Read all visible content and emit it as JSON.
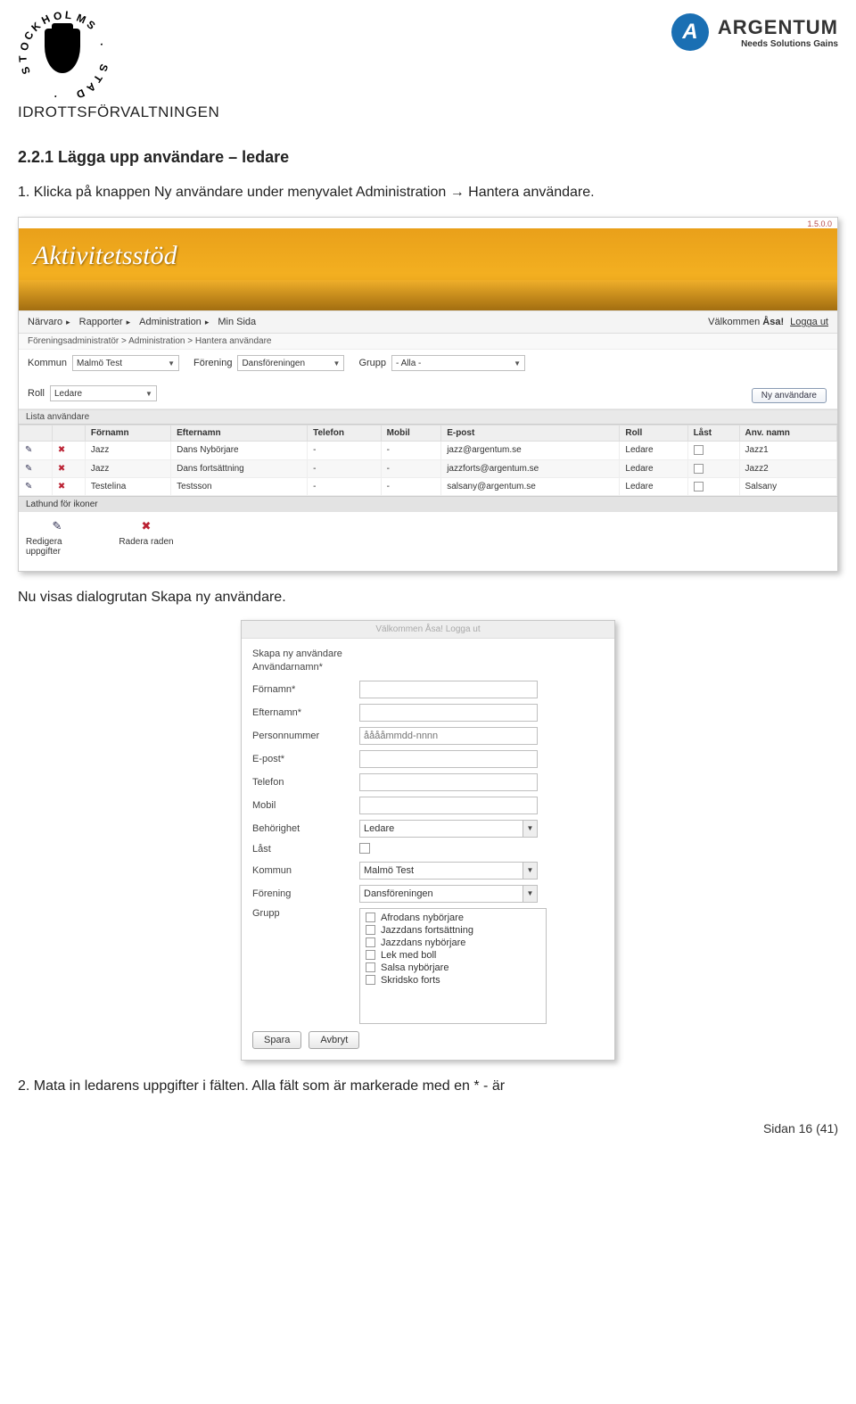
{
  "header": {
    "stockholm_ring_text": "STOCKHOLMS · STAD ·",
    "department": "IDROTTSFÖRVALTNINGEN",
    "argentum_letter": "A",
    "argentum_brand": "ARGENTUM",
    "argentum_tagline": "Needs  Solutions  Gains"
  },
  "section_title": "2.2.1 Lägga upp användare – ledare",
  "step1": "1. Klicka på knappen Ny användare under menyvalet Administration → Hantera användare.",
  "screenshot1": {
    "version": "1.5.0.0",
    "app_name": "Aktivitetsstöd",
    "tabs": [
      "Närvaro",
      "Rapporter",
      "Administration",
      "Min Sida"
    ],
    "welcome_pre": "Välkommen ",
    "welcome_name": "Åsa!",
    "logout": "Logga ut",
    "breadcrumb": "Föreningsadministratör > Administration > Hantera användare",
    "filters": {
      "kommun_label": "Kommun",
      "kommun_value": "Malmö Test",
      "forening_label": "Förening",
      "forening_value": "Dansföreningen",
      "grupp_label": "Grupp",
      "grupp_value": "- Alla -",
      "roll_label": "Roll",
      "roll_value": "Ledare"
    },
    "newuser_btn": "Ny användare",
    "list_label": "Lista användare",
    "columns": [
      "",
      "",
      "Förnamn",
      "Efternamn",
      "Telefon",
      "Mobil",
      "E-post",
      "Roll",
      "Låst",
      "Anv. namn"
    ],
    "rows": [
      {
        "fornamn": "Jazz",
        "efternamn": "Dans Nybörjare",
        "telefon": "-",
        "mobil": "-",
        "epost": "jazz@argentum.se",
        "roll": "Ledare",
        "last": false,
        "anv": "Jazz1"
      },
      {
        "fornamn": "Jazz",
        "efternamn": "Dans fortsättning",
        "telefon": "-",
        "mobil": "-",
        "epost": "jazzforts@argentum.se",
        "roll": "Ledare",
        "last": false,
        "anv": "Jazz2"
      },
      {
        "fornamn": "Testelina",
        "efternamn": "Testsson",
        "telefon": "-",
        "mobil": "-",
        "epost": "salsany@argentum.se",
        "roll": "Ledare",
        "last": false,
        "anv": "Salsany"
      }
    ],
    "legend_title": "Lathund för ikoner",
    "legend_edit": "Redigera uppgifter",
    "legend_delete": "Radera raden"
  },
  "between_text": "Nu visas dialogrutan Skapa ny användare.",
  "screenshot2": {
    "dim_header": "Välkommen Åsa!  Logga ut",
    "title_line1": "Skapa ny användare",
    "title_line2": "Användarnamn*",
    "fields": {
      "fornamn": "Förnamn*",
      "efternamn": "Efternamn*",
      "personnummer": "Personnummer",
      "personnummer_ph": "ååååmmdd-nnnn",
      "epost": "E-post*",
      "telefon": "Telefon",
      "mobil": "Mobil",
      "behorighet": "Behörighet",
      "behorighet_val": "Ledare",
      "last": "Låst",
      "kommun": "Kommun",
      "kommun_val": "Malmö Test",
      "forening": "Förening",
      "forening_val": "Dansföreningen",
      "grupp": "Grupp"
    },
    "grupp_options": [
      "Afrodans nybörjare",
      "Jazzdans fortsättning",
      "Jazzdans nybörjare",
      "Lek med boll",
      "Salsa nybörjare",
      "Skridsko forts"
    ],
    "spara": "Spara",
    "avbryt": "Avbryt"
  },
  "step2": "2. Mata in ledarens uppgifter i fälten. Alla fält som är markerade med en * - är",
  "footer": "Sidan 16 (41)"
}
